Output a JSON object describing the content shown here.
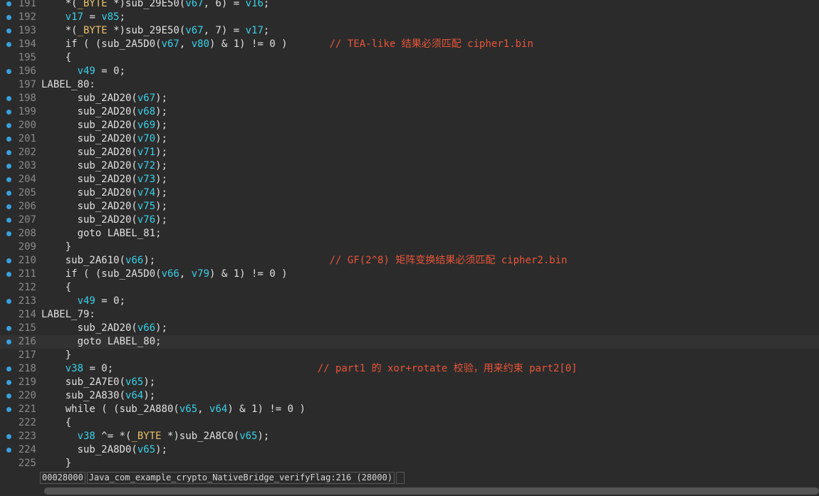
{
  "code": {
    "lines": [
      {
        "n": "191",
        "bp": true,
        "tokens": [
          [
            "    *(",
            ""
          ],
          [
            "_BYTE",
            "typ"
          ],
          [
            " *)sub_29E50(",
            ""
          ],
          [
            "v67",
            "var"
          ],
          [
            ", 6) = ",
            ""
          ],
          [
            "v16",
            "var"
          ],
          [
            ";",
            ""
          ]
        ]
      },
      {
        "n": "192",
        "bp": true,
        "tokens": [
          [
            "    ",
            ""
          ],
          [
            "v17",
            "var"
          ],
          [
            " = ",
            ""
          ],
          [
            "v85",
            "var"
          ],
          [
            ";",
            ""
          ]
        ]
      },
      {
        "n": "193",
        "bp": true,
        "tokens": [
          [
            "    *(",
            ""
          ],
          [
            "_BYTE",
            "typ"
          ],
          [
            " *)sub_29E50(",
            ""
          ],
          [
            "v67",
            "var"
          ],
          [
            ", 7) = ",
            ""
          ],
          [
            "v17",
            "var"
          ],
          [
            ";",
            ""
          ]
        ]
      },
      {
        "n": "194",
        "bp": true,
        "tokens": [
          [
            "    if ( (sub_2A5D0(",
            ""
          ],
          [
            "v67",
            "var"
          ],
          [
            ", ",
            ""
          ],
          [
            "v80",
            "var"
          ],
          [
            ") & 1) != 0 )       ",
            ""
          ],
          [
            "// TEA-like 结果必须匹配 cipher1.bin",
            "cmt"
          ]
        ]
      },
      {
        "n": "195",
        "bp": false,
        "tokens": [
          [
            "    {",
            ""
          ]
        ]
      },
      {
        "n": "196",
        "bp": true,
        "tokens": [
          [
            "      ",
            ""
          ],
          [
            "v49",
            "var"
          ],
          [
            " = 0;",
            ""
          ]
        ]
      },
      {
        "n": "197",
        "bp": false,
        "tokens": [
          [
            "LABEL_80:",
            ""
          ]
        ]
      },
      {
        "n": "198",
        "bp": true,
        "tokens": [
          [
            "      sub_2AD20(",
            ""
          ],
          [
            "v67",
            "var"
          ],
          [
            ");",
            ""
          ]
        ]
      },
      {
        "n": "199",
        "bp": true,
        "tokens": [
          [
            "      sub_2AD20(",
            ""
          ],
          [
            "v68",
            "var"
          ],
          [
            ");",
            ""
          ]
        ]
      },
      {
        "n": "200",
        "bp": true,
        "tokens": [
          [
            "      sub_2AD20(",
            ""
          ],
          [
            "v69",
            "var"
          ],
          [
            ");",
            ""
          ]
        ]
      },
      {
        "n": "201",
        "bp": true,
        "tokens": [
          [
            "      sub_2AD20(",
            ""
          ],
          [
            "v70",
            "var"
          ],
          [
            ");",
            ""
          ]
        ]
      },
      {
        "n": "202",
        "bp": true,
        "tokens": [
          [
            "      sub_2AD20(",
            ""
          ],
          [
            "v71",
            "var"
          ],
          [
            ");",
            ""
          ]
        ]
      },
      {
        "n": "203",
        "bp": true,
        "tokens": [
          [
            "      sub_2AD20(",
            ""
          ],
          [
            "v72",
            "var"
          ],
          [
            ");",
            ""
          ]
        ]
      },
      {
        "n": "204",
        "bp": true,
        "tokens": [
          [
            "      sub_2AD20(",
            ""
          ],
          [
            "v73",
            "var"
          ],
          [
            ");",
            ""
          ]
        ]
      },
      {
        "n": "205",
        "bp": true,
        "tokens": [
          [
            "      sub_2AD20(",
            ""
          ],
          [
            "v74",
            "var"
          ],
          [
            ");",
            ""
          ]
        ]
      },
      {
        "n": "206",
        "bp": true,
        "tokens": [
          [
            "      sub_2AD20(",
            ""
          ],
          [
            "v75",
            "var"
          ],
          [
            ");",
            ""
          ]
        ]
      },
      {
        "n": "207",
        "bp": true,
        "tokens": [
          [
            "      sub_2AD20(",
            ""
          ],
          [
            "v76",
            "var"
          ],
          [
            ");",
            ""
          ]
        ]
      },
      {
        "n": "208",
        "bp": true,
        "tokens": [
          [
            "      goto LABEL_81;",
            ""
          ]
        ]
      },
      {
        "n": "209",
        "bp": false,
        "tokens": [
          [
            "    }",
            ""
          ]
        ]
      },
      {
        "n": "210",
        "bp": true,
        "tokens": [
          [
            "    sub_2A610(",
            ""
          ],
          [
            "v66",
            "var"
          ],
          [
            ");                             ",
            ""
          ],
          [
            "// GF(2^8) 矩阵变换结果必须匹配 cipher2.bin",
            "cmt"
          ]
        ]
      },
      {
        "n": "211",
        "bp": true,
        "tokens": [
          [
            "    if ( (sub_2A5D0(",
            ""
          ],
          [
            "v66",
            "var"
          ],
          [
            ", ",
            ""
          ],
          [
            "v79",
            "var"
          ],
          [
            ") & 1) != 0 )",
            ""
          ]
        ]
      },
      {
        "n": "212",
        "bp": false,
        "tokens": [
          [
            "    {",
            ""
          ]
        ]
      },
      {
        "n": "213",
        "bp": true,
        "tokens": [
          [
            "      ",
            ""
          ],
          [
            "v49",
            "var"
          ],
          [
            " = 0;",
            ""
          ]
        ]
      },
      {
        "n": "214",
        "bp": false,
        "tokens": [
          [
            "LABEL_79:",
            ""
          ]
        ]
      },
      {
        "n": "215",
        "bp": true,
        "tokens": [
          [
            "      sub_2AD20(",
            ""
          ],
          [
            "v66",
            "var"
          ],
          [
            ");",
            ""
          ]
        ]
      },
      {
        "n": "216",
        "bp": true,
        "tokens": [
          [
            "      goto LABEL_80;",
            ""
          ]
        ],
        "current": true
      },
      {
        "n": "217",
        "bp": false,
        "tokens": [
          [
            "    }",
            ""
          ]
        ]
      },
      {
        "n": "218",
        "bp": true,
        "tokens": [
          [
            "    ",
            ""
          ],
          [
            "v38",
            "var"
          ],
          [
            " = 0;                                  ",
            ""
          ],
          [
            "// part1 的 xor+rotate 校验，用来约束 part2[0]",
            "cmt"
          ]
        ]
      },
      {
        "n": "219",
        "bp": true,
        "tokens": [
          [
            "    sub_2A7E0(",
            ""
          ],
          [
            "v65",
            "var"
          ],
          [
            ");",
            ""
          ]
        ]
      },
      {
        "n": "220",
        "bp": true,
        "tokens": [
          [
            "    sub_2A830(",
            ""
          ],
          [
            "v64",
            "var"
          ],
          [
            ");",
            ""
          ]
        ]
      },
      {
        "n": "221",
        "bp": true,
        "tokens": [
          [
            "    while ( (sub_2A880(",
            ""
          ],
          [
            "v65",
            "var"
          ],
          [
            ", ",
            ""
          ],
          [
            "v64",
            "var"
          ],
          [
            ") & 1) != 0 )",
            ""
          ]
        ]
      },
      {
        "n": "222",
        "bp": false,
        "tokens": [
          [
            "    {",
            ""
          ]
        ]
      },
      {
        "n": "223",
        "bp": true,
        "tokens": [
          [
            "      ",
            ""
          ],
          [
            "v38",
            "var"
          ],
          [
            " ^= *(",
            ""
          ],
          [
            "_BYTE",
            "typ"
          ],
          [
            " *)sub_2A8C0(",
            ""
          ],
          [
            "v65",
            "var"
          ],
          [
            ");",
            ""
          ]
        ]
      },
      {
        "n": "224",
        "bp": true,
        "tokens": [
          [
            "      sub_2A8D0(",
            ""
          ],
          [
            "v65",
            "var"
          ],
          [
            ");",
            ""
          ]
        ]
      },
      {
        "n": "225",
        "bp": false,
        "tokens": [
          [
            "    }",
            ""
          ]
        ]
      }
    ]
  },
  "status": {
    "address": "00028000",
    "location": "Java_com_example_crypto_NativeBridge_verifyFlag:216 (28000)"
  },
  "colors": {
    "background": "#2b2b2b",
    "breakpoint": "#3aa0de",
    "variable": "#3ad0e8",
    "type": "#e8c06a",
    "comment": "#e8563a",
    "line_number": "#8a8a8a"
  }
}
